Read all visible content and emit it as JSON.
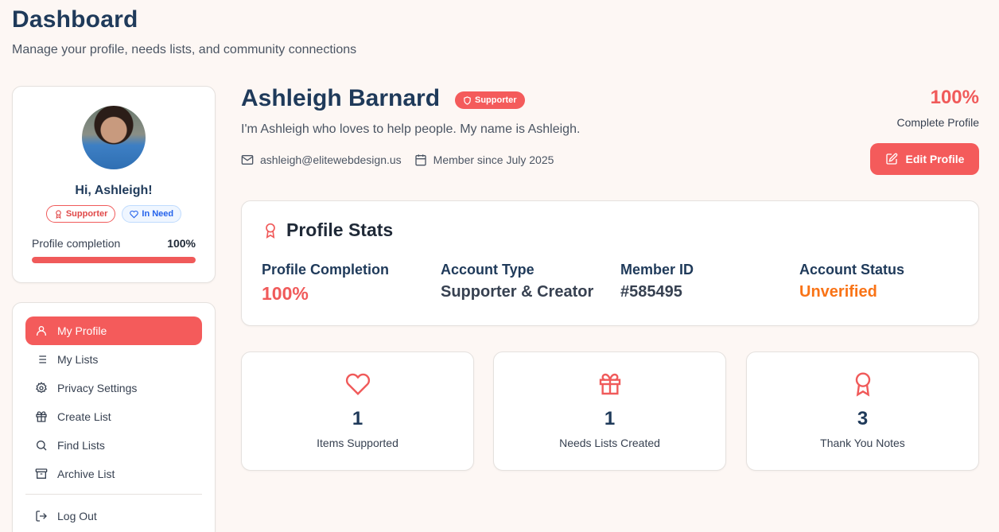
{
  "header": {
    "title": "Dashboard",
    "subtitle": "Manage your profile, needs lists, and community connections"
  },
  "sidebar_profile": {
    "greeting": "Hi, Ashleigh!",
    "badges": [
      "Supporter",
      "In Need"
    ],
    "completion_label": "Profile completion",
    "completion_value": "100%",
    "completion_fraction": 1.0
  },
  "nav": {
    "items": [
      {
        "label": "My Profile",
        "icon": "user-icon",
        "active": true
      },
      {
        "label": "My Lists",
        "icon": "list-icon",
        "active": false
      },
      {
        "label": "Privacy Settings",
        "icon": "gear-icon",
        "active": false
      },
      {
        "label": "Create List",
        "icon": "gift-icon",
        "active": false
      },
      {
        "label": "Find Lists",
        "icon": "search-icon",
        "active": false
      },
      {
        "label": "Archive List",
        "icon": "archive-icon",
        "active": false
      }
    ],
    "logout": {
      "label": "Log Out",
      "icon": "logout-icon"
    }
  },
  "profile": {
    "name": "Ashleigh Barnard",
    "role_badge": "Supporter",
    "bio": "I'm Ashleigh who loves to help people. My name is Ashleigh.",
    "email": "ashleigh@elitewebdesign.us",
    "member_since": "Member since July 2025",
    "complete_pct": "100%",
    "complete_label": "Complete Profile",
    "edit_label": "Edit Profile"
  },
  "stats": {
    "title": "Profile Stats",
    "items": [
      {
        "label": "Profile Completion",
        "value": "100%"
      },
      {
        "label": "Account Type",
        "value": "Supporter & Creator"
      },
      {
        "label": "Member ID",
        "value": "#585495"
      },
      {
        "label": "Account Status",
        "value": "Unverified"
      }
    ]
  },
  "summary_cards": [
    {
      "number": "1",
      "label": "Items Supported",
      "icon": "heart-icon"
    },
    {
      "number": "1",
      "label": "Needs Lists Created",
      "icon": "gift-icon"
    },
    {
      "number": "3",
      "label": "Thank You Notes",
      "icon": "award-icon"
    }
  ],
  "colors": {
    "accent": "#f45b5b",
    "navy": "#1f3a5a",
    "orange": "#f97316",
    "background": "#fdf7f4"
  }
}
